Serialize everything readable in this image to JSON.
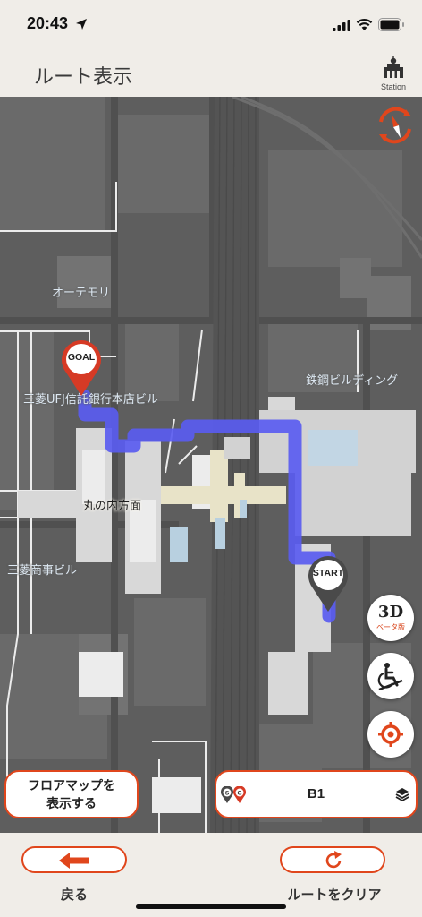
{
  "status_bar": {
    "time": "20:43"
  },
  "header": {
    "title": "ルート表示",
    "station_label": "Station"
  },
  "map": {
    "labels": {
      "otemori": "オーテモリ",
      "mufg": "三菱UFJ信託銀行本店ビル",
      "tekko": "鉄鋼ビルディング",
      "marunouchi": "丸の内方面",
      "mitsubishi_shoji": "三菱商事ビル"
    },
    "goal_pin": "GOAL",
    "start_pin": "START",
    "route_color": "#5a5cf0",
    "accent_color": "#e0461c"
  },
  "controls": {
    "btn_3d": "3D",
    "btn_3d_sub": "ベータ版",
    "floor_map_line1": "フロアマップを",
    "floor_map_line2": "表示する",
    "floor": "B1"
  },
  "footer": {
    "back_label": "戻る",
    "clear_label": "ルートをクリア"
  }
}
